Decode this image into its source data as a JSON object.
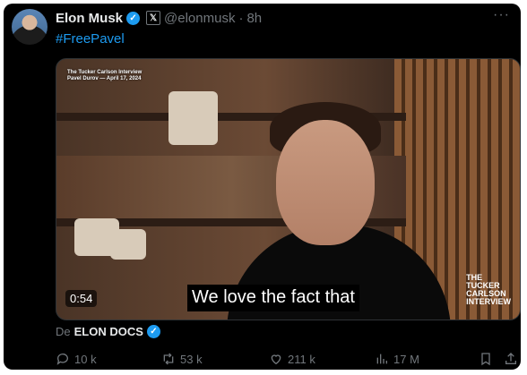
{
  "tweet": {
    "author_name": "Elon Musk",
    "handle": "@elonmusk",
    "separator": "·",
    "time": "8h",
    "more": "···",
    "hashtag": "#FreePavel",
    "x_badge": "𝕏"
  },
  "media": {
    "corner_line1": "The Tucker Carlson Interview",
    "corner_line2": "Pavel Durov — April 17, 2024",
    "duration": "0:54",
    "subtitle": "We love the fact that",
    "logo_line1": "THE",
    "logo_line2": "TUCKER",
    "logo_line3": "CARLSON",
    "logo_line4": "INTERVIEW"
  },
  "source": {
    "prefix": "De",
    "name": "ELON DOCS"
  },
  "actions": {
    "replies": "10 k",
    "reposts": "53 k",
    "likes": "211 k",
    "views": "17 M"
  },
  "colors": {
    "background": "#000000",
    "accent": "#1d9bf0",
    "muted": "#71767b",
    "text": "#e7e9ea"
  }
}
